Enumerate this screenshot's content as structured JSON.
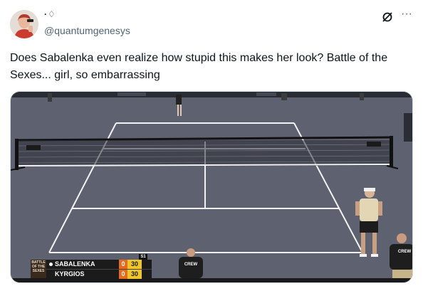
{
  "author": {
    "display_name": "·♢",
    "handle": "@quantumgenesys",
    "avatar": "user-avatar"
  },
  "header": {
    "grok_icon": "grok-icon",
    "more_icon": "more-options-icon",
    "more_glyph": "···"
  },
  "tweet": {
    "text": "Does Sabalenka even realize how stupid this makes her look? Battle of the Sexes... girl, so embarrassing"
  },
  "media": {
    "scene": "tennis-court-video-frame",
    "colors": {
      "court": "#5f6370",
      "lines": "#f2f2f2",
      "net": "#1a1a1a"
    },
    "shirt_text": "CREW",
    "scoreboard": {
      "logo_text": "BATTLE OF THE SEXES",
      "set_label": "S1",
      "players": [
        {
          "name": "SABALENKA",
          "set": "0",
          "points": "30",
          "serving": true
        },
        {
          "name": "KYRGIOS",
          "set": "0",
          "points": "30",
          "serving": false
        }
      ]
    }
  }
}
